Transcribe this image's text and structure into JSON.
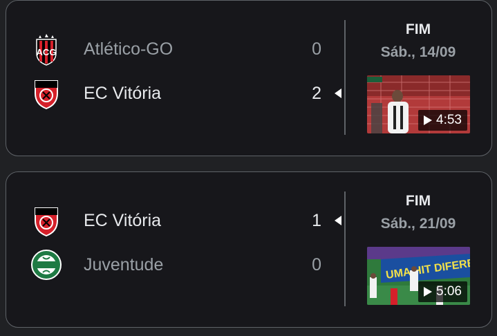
{
  "matches": [
    {
      "home": {
        "name": "Atlético-GO",
        "score": "0",
        "logo": "atletico-go-crest"
      },
      "away": {
        "name": "EC Vitória",
        "score": "2",
        "logo": "vitoria-crest"
      },
      "status": "FIM",
      "date": "Sáb., 14/09",
      "video_duration": "4:53",
      "winner": "away"
    },
    {
      "home": {
        "name": "EC Vitória",
        "score": "1",
        "logo": "vitoria-crest"
      },
      "away": {
        "name": "Juventude",
        "score": "0",
        "logo": "juventude-crest"
      },
      "status": "FIM",
      "date": "Sáb., 21/09",
      "video_duration": "5:06",
      "winner": "home"
    }
  ],
  "colors": {
    "background": "#17171b",
    "border": "#5f6368",
    "text_primary": "#e8eaed",
    "text_secondary": "#9aa0a6",
    "vitoria_red": "#d5202a",
    "juventude_green": "#1e7a43"
  }
}
